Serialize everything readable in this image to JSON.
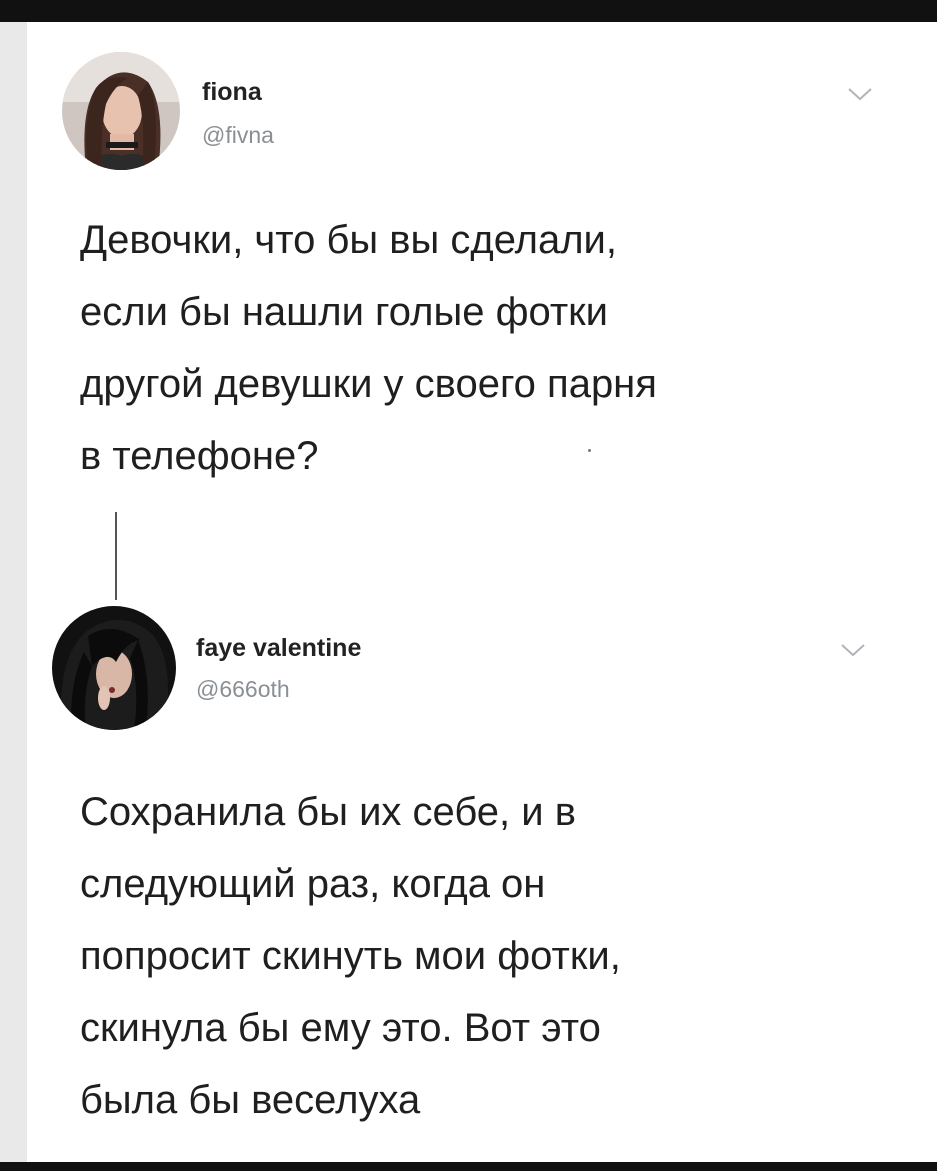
{
  "tweets": [
    {
      "display_name": "fiona",
      "handle": "@fivna",
      "menu_icon": "chevron-down-icon",
      "text_lines": [
        "Девочки, что бы вы сделали,",
        "если бы нашли голые фотки",
        "другой девушки у своего парня",
        "в телефоне?"
      ]
    },
    {
      "display_name": "faye valentine",
      "handle": "@666oth",
      "menu_icon": "chevron-down-icon",
      "text_lines": [
        "Сохранила бы их себе, и в",
        "следующий раз, когда он",
        "попросит скинуть мои фотки,",
        "скинула бы ему это. Вот это",
        "была бы веселуха"
      ]
    }
  ],
  "colors": {
    "text": "#1f1f1f",
    "handle": "#8a8f94",
    "chevron": "#b0b5ba",
    "thread_line": "#555555",
    "frame": "#111111"
  }
}
